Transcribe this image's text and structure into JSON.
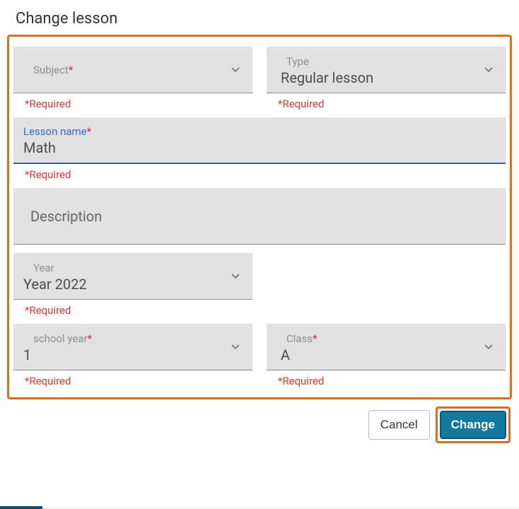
{
  "title": "Change lesson",
  "required_text": "*Required",
  "fields": {
    "subject": {
      "label": "Subject",
      "required": true,
      "value": ""
    },
    "type": {
      "label": "Type",
      "required": false,
      "value": "Regular lesson"
    },
    "lesson_name": {
      "label": "Lesson name",
      "required": true,
      "value": "Math"
    },
    "description": {
      "label": "Description",
      "required": false,
      "value": ""
    },
    "year": {
      "label": "Year",
      "required": false,
      "value": "Year 2022"
    },
    "school_year": {
      "label": "school year",
      "required": true,
      "value": "1"
    },
    "class": {
      "label": "Class",
      "required": true,
      "value": "A"
    }
  },
  "buttons": {
    "cancel": "Cancel",
    "change": "Change"
  },
  "colors": {
    "highlight": "#e86a18",
    "primary": "#117a9e",
    "required": "#e2372f",
    "focused_label": "#3a6cd6"
  }
}
